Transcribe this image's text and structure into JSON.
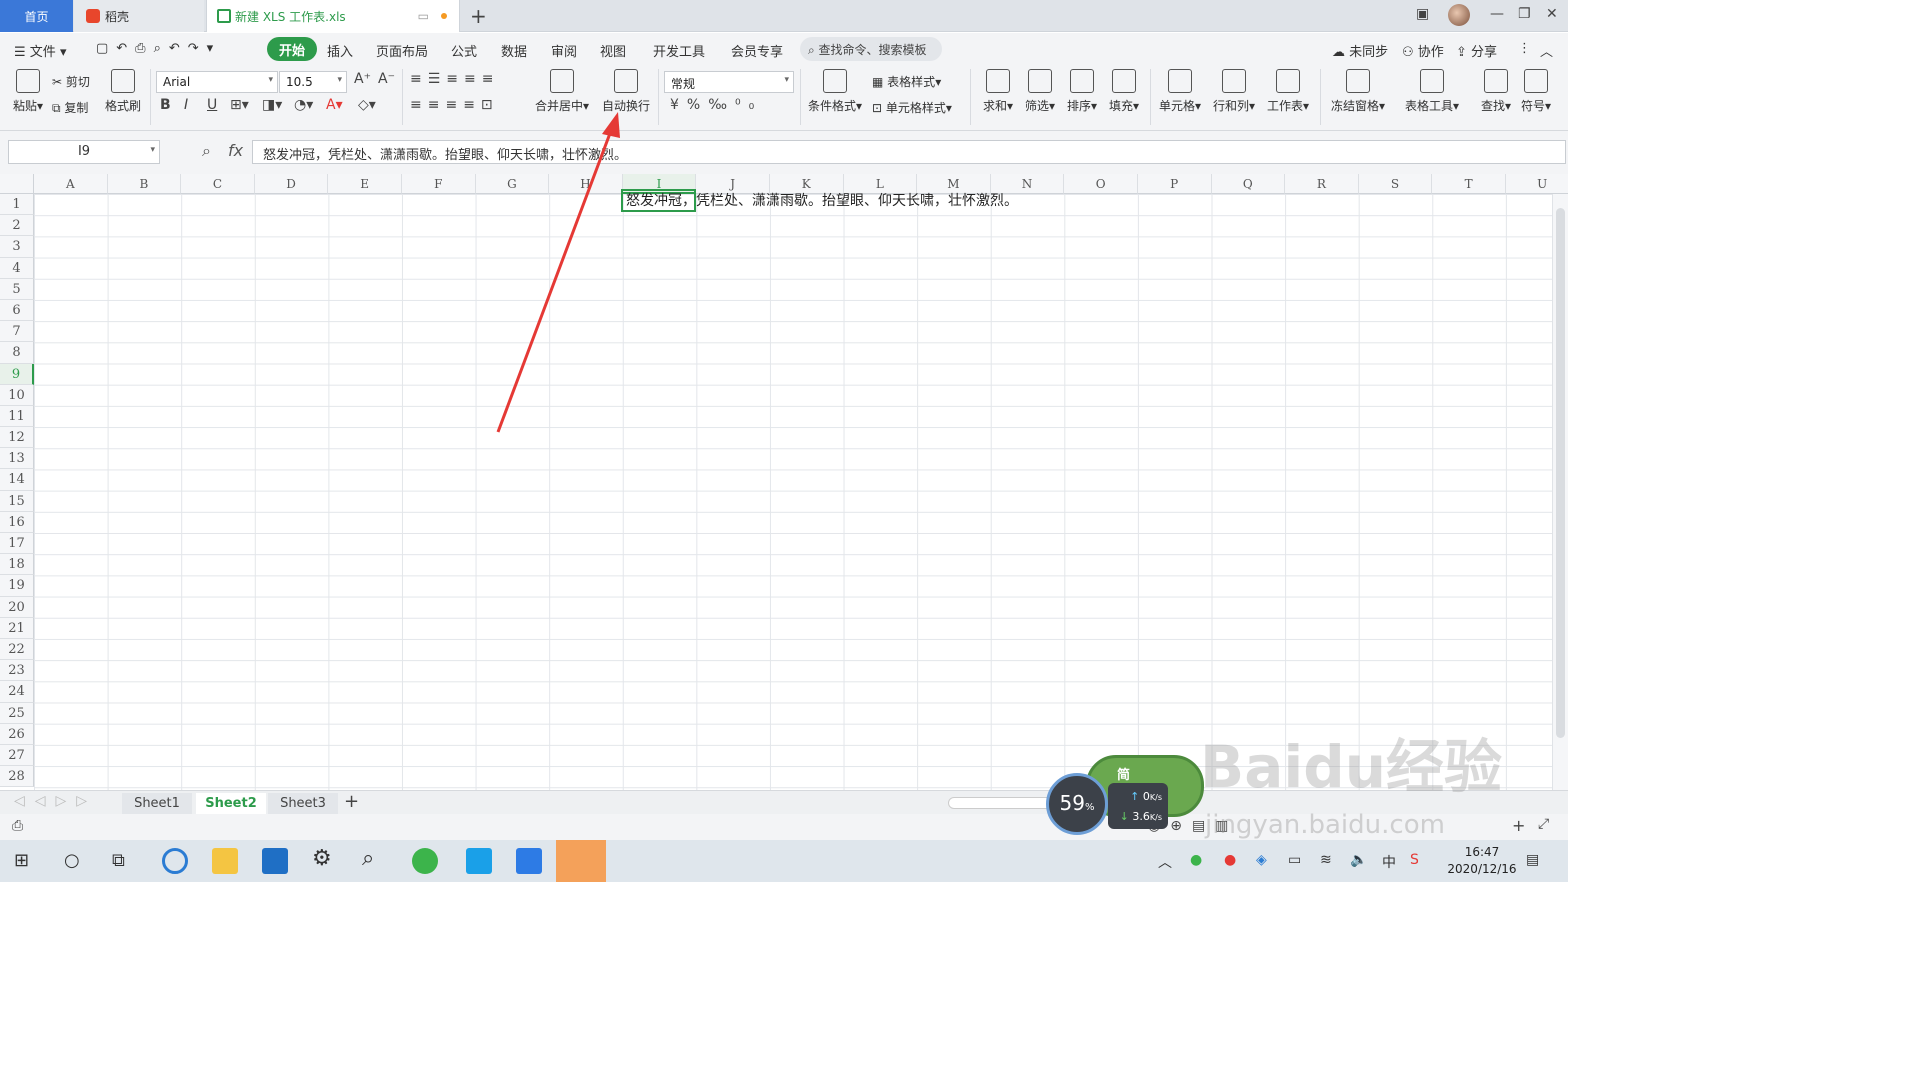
{
  "tabs": {
    "home": "首页",
    "daoke": "稻壳",
    "file": "新建 XLS 工作表.xls"
  },
  "menu": {
    "file": "文件",
    "items": [
      "开始",
      "插入",
      "页面布局",
      "公式",
      "数据",
      "审阅",
      "视图",
      "开发工具",
      "会员专享"
    ],
    "search": "查找命令、搜索模板",
    "right": [
      "未同步",
      "协作",
      "分享"
    ]
  },
  "ribbon": {
    "paste": "粘贴",
    "cut": "剪切",
    "copy": "复制",
    "format_painter": "格式刷",
    "font": "Arial",
    "size": "10.5",
    "merge": "合并居中",
    "wrap": "自动换行",
    "numfmt": "常规",
    "cond_format": "条件格式",
    "table_style": "表格样式",
    "cell_style": "单元格样式",
    "sum": "求和",
    "filter": "筛选",
    "sort": "排序",
    "fill": "填充",
    "cell": "单元格",
    "rowcol": "行和列",
    "sheet": "工作表",
    "freeze": "冻结窗格",
    "table_tools": "表格工具",
    "find": "查找",
    "symbol": "符号"
  },
  "formula": {
    "cellref": "I9",
    "content": "怒发冲冠，凭栏处、潇潇雨歇。抬望眼、仰天长啸，壮怀激烈。"
  },
  "grid": {
    "columns": [
      "A",
      "B",
      "C",
      "D",
      "E",
      "F",
      "G",
      "H",
      "I",
      "J",
      "K",
      "L",
      "M",
      "N",
      "O",
      "P",
      "Q",
      "R",
      "S",
      "T",
      "U"
    ],
    "rows": [
      "1",
      "2",
      "3",
      "4",
      "5",
      "6",
      "7",
      "8",
      "9",
      "10",
      "11",
      "12",
      "13",
      "14",
      "15",
      "16",
      "17",
      "18",
      "19",
      "20",
      "21",
      "22",
      "23",
      "24",
      "25",
      "26",
      "27",
      "28"
    ],
    "selected_col": "I",
    "selected_row": "9",
    "cell_text": "怒发冲冠，凭栏处、潇潇雨歇。抬望眼、仰天长啸，壮怀激烈。"
  },
  "sheets": [
    "Sheet1",
    "Sheet2",
    "Sheet3"
  ],
  "active_sheet": "Sheet2",
  "widget": {
    "label": "简",
    "percent": "59",
    "percent_unit": "%",
    "up": "0",
    "down": "3.6",
    "rate_unit": "K/s"
  },
  "watermark": {
    "main": "Baidu经验",
    "url": "jingyan.baidu.com"
  },
  "taskbar": {
    "time": "16:47",
    "date": "2020/12/16",
    "ime": "中"
  },
  "colors": {
    "accent": "#2d9b4b",
    "home_tab": "#3b78d8",
    "annotation": "#e53935"
  }
}
